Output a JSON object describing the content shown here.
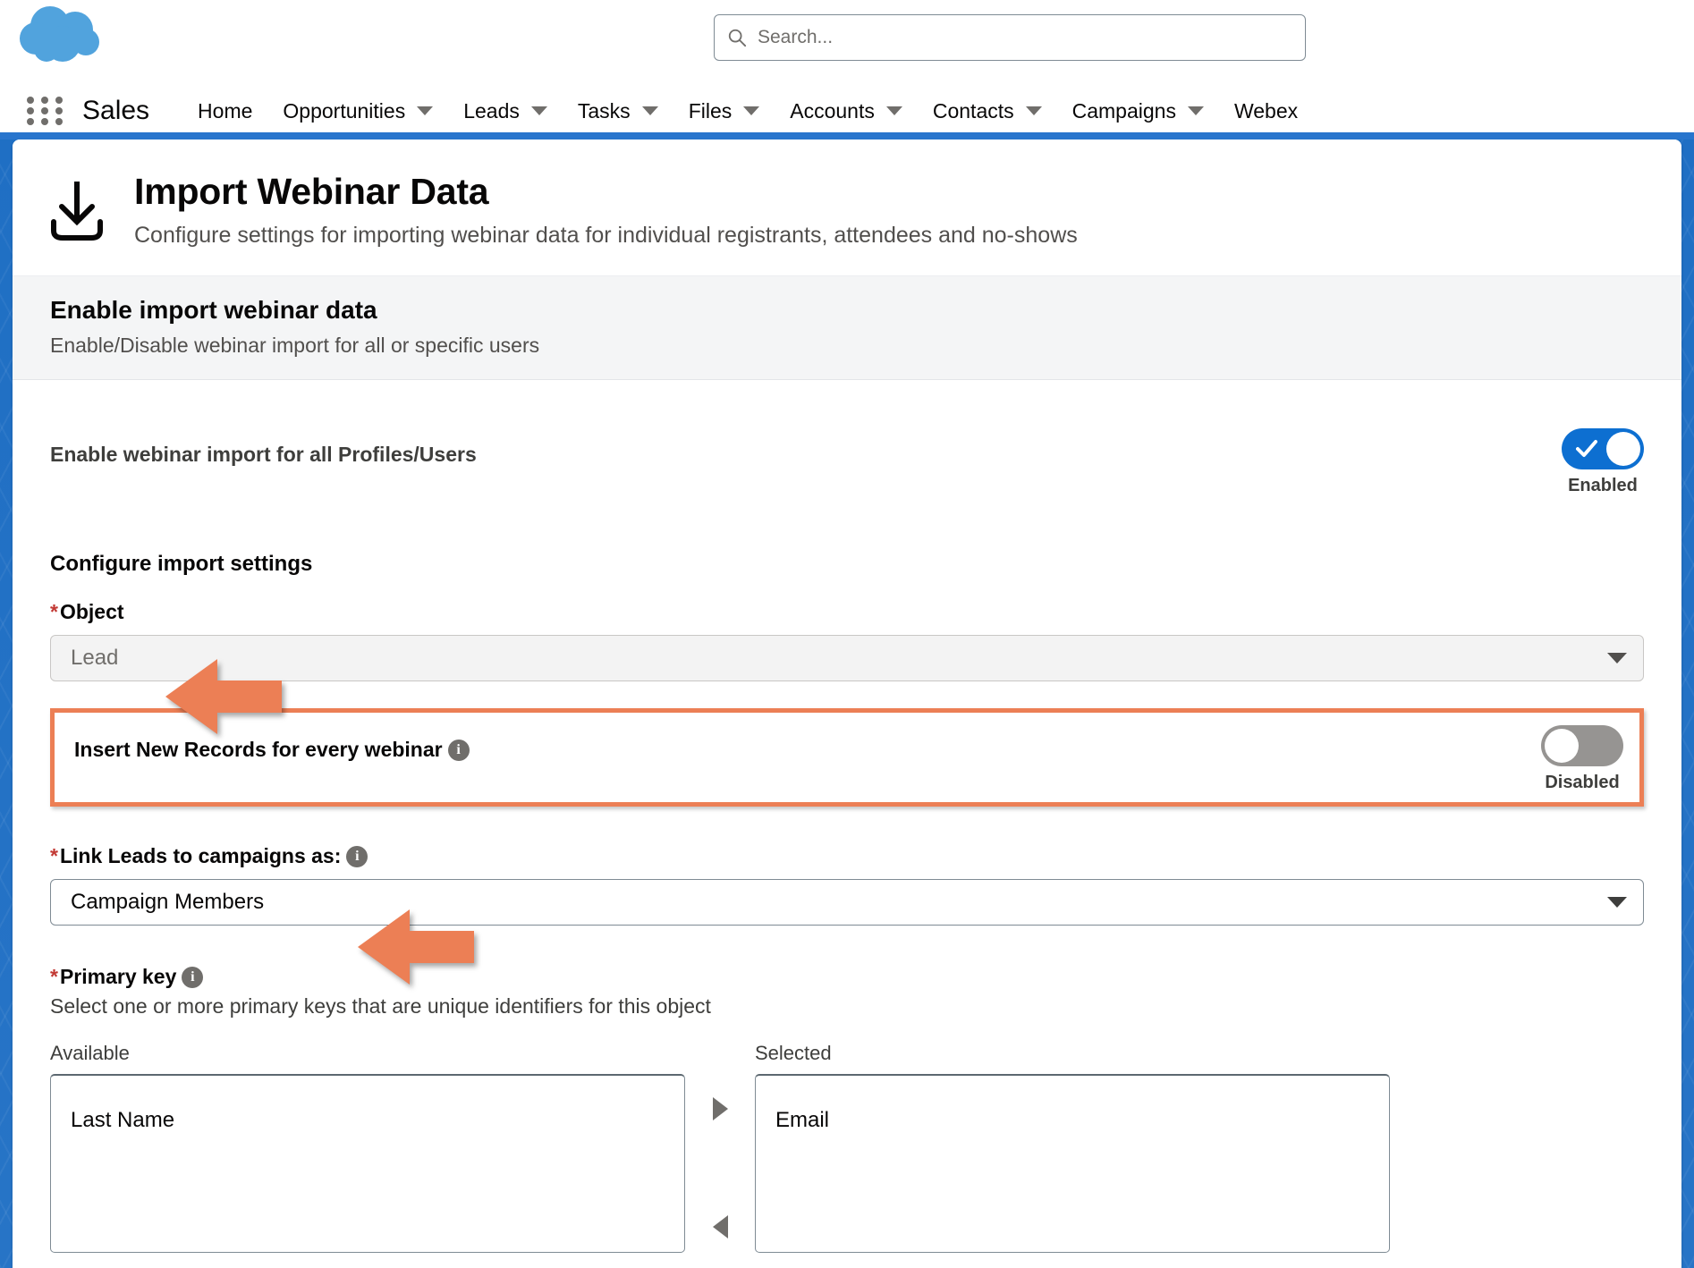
{
  "global_header": {
    "logo_icon": "salesforce-cloud-logo",
    "search": {
      "icon": "search-icon",
      "placeholder": "Search...",
      "value": ""
    }
  },
  "nav": {
    "app_launcher_icon": "app-launcher-grid-icon",
    "app_name": "Sales",
    "items": [
      {
        "label": "Home",
        "has_caret": false
      },
      {
        "label": "Opportunities",
        "has_caret": true
      },
      {
        "label": "Leads",
        "has_caret": true
      },
      {
        "label": "Tasks",
        "has_caret": true
      },
      {
        "label": "Files",
        "has_caret": true
      },
      {
        "label": "Accounts",
        "has_caret": true
      },
      {
        "label": "Contacts",
        "has_caret": true
      },
      {
        "label": "Campaigns",
        "has_caret": true
      },
      {
        "label": "Webex",
        "has_caret": false
      }
    ]
  },
  "page": {
    "icon": "download-tray-icon",
    "title": "Import Webinar Data",
    "subtitle": "Configure settings for importing webinar data for individual registrants, attendees and no-shows"
  },
  "section": {
    "heading": "Enable import webinar data",
    "description": "Enable/Disable webinar import for all or specific users"
  },
  "enable_all": {
    "label": "Enable webinar import for all Profiles/Users",
    "toggle_state": "on",
    "toggle_label": "Enabled"
  },
  "configure": {
    "heading": "Configure import settings",
    "object_field": {
      "required_mark": "*",
      "label": "Object",
      "value": "Lead",
      "disabled": true,
      "caret_icon": "chevron-down-icon"
    },
    "insert_new_records": {
      "label": "Insert New Records for every webinar",
      "info_icon": "info-icon",
      "info_glyph": "i",
      "toggle_state": "off",
      "toggle_label": "Disabled",
      "highlighted": true
    },
    "link_leads": {
      "required_mark": "*",
      "label": "Link Leads to campaigns as:",
      "info_icon": "info-icon",
      "info_glyph": "i",
      "value": "Campaign Members",
      "caret_icon": "chevron-down-icon"
    },
    "primary_key": {
      "required_mark": "*",
      "label": "Primary key",
      "info_icon": "info-icon",
      "info_glyph": "i",
      "description": "Select one or more primary keys that are unique identifiers for this object",
      "available_caption": "Available",
      "selected_caption": "Selected",
      "available_options": [
        "Last Name"
      ],
      "selected_options": [
        "Email"
      ],
      "move_right_icon": "triangle-right-icon",
      "move_left_icon": "triangle-left-icon"
    }
  },
  "annotations": {
    "arrows": [
      {
        "name": "arrow-pointing-to-object-field",
        "direction": "left"
      },
      {
        "name": "arrow-pointing-to-link-leads-field",
        "direction": "left"
      }
    ],
    "highlight_box": {
      "name": "insert-new-records-highlight"
    }
  },
  "colors": {
    "brand_blue": "#1f6fc4",
    "toggle_on": "#0d6fd1",
    "toggle_off": "#969492",
    "annotation_orange": "#ec7f55",
    "required_red": "#c23934",
    "cloud_blue": "#51a3dd"
  }
}
